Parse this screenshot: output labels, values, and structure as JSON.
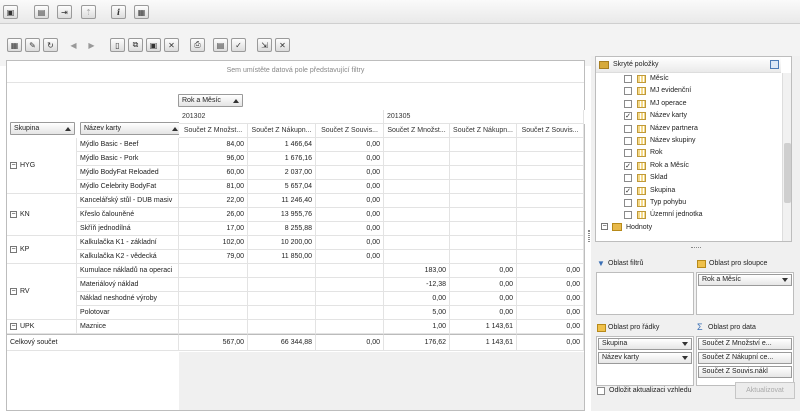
{
  "toolbar_top": {
    "icons": [
      "save-icon",
      "window-icon",
      "import-icon",
      "export-icon",
      "info-icon",
      "calculator-icon"
    ],
    "info_label": "i"
  },
  "toolbar": {
    "icons": [
      "table-icon",
      "edit-table-icon",
      "refresh-table-icon",
      "back-arrow-icon",
      "forward-arrow-icon",
      "new-document-icon",
      "copy-icon",
      "save-icon",
      "delete-icon",
      "print-icon",
      "grid-icon",
      "chart-icon",
      "export-icon",
      "close-icon"
    ]
  },
  "pivot": {
    "filter_hint": "Sem umístěte datová pole představující filtry",
    "column_field": "Rok a Měsíc",
    "row_fields": [
      "Skupina",
      "Název karty"
    ],
    "periods": [
      "201302",
      "201305"
    ],
    "measures": [
      "Součet Z Množst...",
      "Součet Z Nákupn...",
      "Součet Z Souvis..."
    ],
    "groups": [
      {
        "name": "HYG",
        "rows": [
          {
            "item": "Mýdlo Basic - Beef",
            "v": [
              "84,00",
              "1 466,64",
              "0,00",
              "",
              "",
              ""
            ]
          },
          {
            "item": "Mýdlo Basic - Pork",
            "v": [
              "96,00",
              "1 676,16",
              "0,00",
              "",
              "",
              ""
            ]
          },
          {
            "item": "Mýdlo BodyFat Reloaded",
            "v": [
              "60,00",
              "2 037,00",
              "0,00",
              "",
              "",
              ""
            ]
          },
          {
            "item": "Mýdlo Celebrity BodyFat",
            "v": [
              "81,00",
              "5 657,04",
              "0,00",
              "",
              "",
              ""
            ]
          }
        ]
      },
      {
        "name": "KN",
        "rows": [
          {
            "item": "Kancelářský stůl - DUB masiv",
            "v": [
              "22,00",
              "11 246,40",
              "0,00",
              "",
              "",
              ""
            ]
          },
          {
            "item": "Křeslo čalouněné",
            "v": [
              "26,00",
              "13 955,76",
              "0,00",
              "",
              "",
              ""
            ]
          },
          {
            "item": "Skříň jednodílná",
            "v": [
              "17,00",
              "8 255,88",
              "0,00",
              "",
              "",
              ""
            ]
          }
        ]
      },
      {
        "name": "KP",
        "rows": [
          {
            "item": "Kalkulačka K1 - základní",
            "v": [
              "102,00",
              "10 200,00",
              "0,00",
              "",
              "",
              ""
            ]
          },
          {
            "item": "Kalkulačka K2 - vědecká",
            "v": [
              "79,00",
              "11 850,00",
              "0,00",
              "",
              "",
              ""
            ]
          }
        ]
      },
      {
        "name": "RV",
        "rows": [
          {
            "item": "Kumulace nákladů na operaci",
            "v": [
              "",
              "",
              "",
              "183,00",
              "0,00",
              "0,00"
            ]
          },
          {
            "item": "Materiálový náklad",
            "v": [
              "",
              "",
              "",
              "-12,38",
              "0,00",
              "0,00"
            ]
          },
          {
            "item": "Náklad neshodné výroby",
            "v": [
              "",
              "",
              "",
              "0,00",
              "0,00",
              "0,00"
            ]
          },
          {
            "item": "Polotovar",
            "v": [
              "",
              "",
              "",
              "5,00",
              "0,00",
              "0,00"
            ]
          }
        ]
      },
      {
        "name": "UPK",
        "rows": [
          {
            "item": "Maznice",
            "v": [
              "",
              "",
              "",
              "1,00",
              "1 143,61",
              "0,00"
            ]
          }
        ]
      }
    ],
    "total_label": "Celkový součet",
    "total": [
      "567,00",
      "66 344,88",
      "0,00",
      "176,62",
      "1 143,61",
      "0,00"
    ]
  },
  "field_list": {
    "header": "Skryté položky",
    "items": [
      {
        "label": "Měsíc",
        "checked": false
      },
      {
        "label": "MJ evidenční",
        "checked": false
      },
      {
        "label": "MJ operace",
        "checked": false
      },
      {
        "label": "Název karty",
        "checked": true
      },
      {
        "label": "Název partnera",
        "checked": false
      },
      {
        "label": "Název skupiny",
        "checked": false
      },
      {
        "label": "Rok",
        "checked": false
      },
      {
        "label": "Rok a Měsíc",
        "checked": true
      },
      {
        "label": "Sklad",
        "checked": false
      },
      {
        "label": "Skupina",
        "checked": true
      },
      {
        "label": "Typ pohybu",
        "checked": false
      },
      {
        "label": "Územní jednotka",
        "checked": false
      }
    ],
    "folder": "Hodnoty",
    "check_mark": "✓"
  },
  "areas": {
    "filters": "Oblast filtrů",
    "columns": "Oblast pro sloupce",
    "columns_items": [
      "Rok a Měsíc"
    ],
    "rows": "Oblast pro řádky",
    "rows_items": [
      "Skupina",
      "Název karty"
    ],
    "data": "Oblast pro data",
    "data_items": [
      "Součet Z Množství e...",
      "Součet Z Nákupní ce...",
      "Součet Z Souvis.nákl"
    ]
  },
  "footer": {
    "defer_label": "Odložit aktualizaci vzhledu",
    "update_button": "Aktualizovat"
  }
}
